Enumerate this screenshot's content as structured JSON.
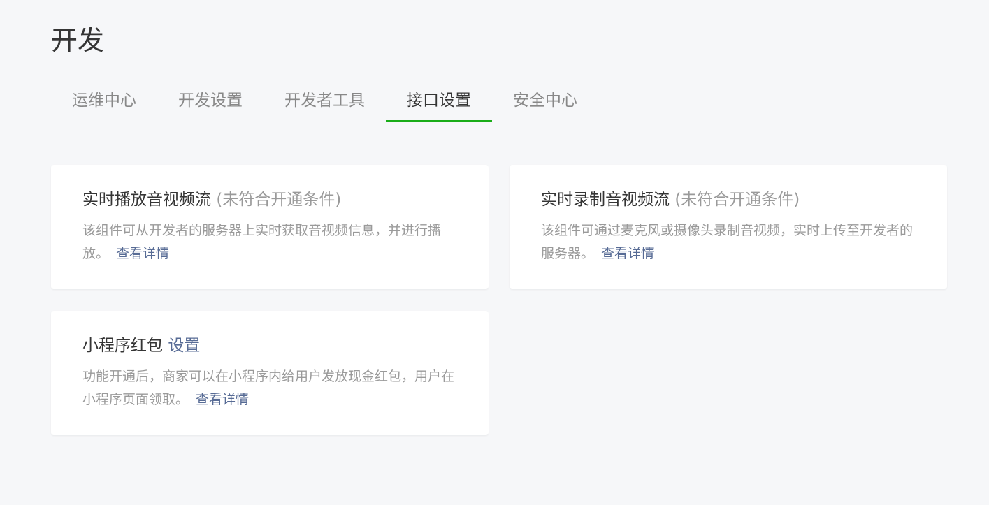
{
  "page": {
    "title": "开发"
  },
  "tabs": [
    {
      "label": "运维中心",
      "active": false
    },
    {
      "label": "开发设置",
      "active": false
    },
    {
      "label": "开发者工具",
      "active": false
    },
    {
      "label": "接口设置",
      "active": true
    },
    {
      "label": "安全中心",
      "active": false
    }
  ],
  "cards": [
    {
      "title": "实时播放音视频流",
      "status": "(未符合开通条件)",
      "description": "该组件可从开发者的服务器上实时获取音视频信息，并进行播放。",
      "link": "查看详情"
    },
    {
      "title": "实时录制音视频流",
      "status": "(未符合开通条件)",
      "description": "该组件可通过麦克风或摄像头录制音视频，实时上传至开发者的服务器。",
      "link": "查看详情"
    },
    {
      "title": "小程序红包",
      "action": "设置",
      "description": "功能开通后，商家可以在小程序内给用户发放现金红包，用户在小程序页面领取。",
      "link": "查看详情"
    }
  ],
  "colors": {
    "background": "#f6f7f9",
    "accent": "#1aad19",
    "link": "#576b95",
    "muted": "#9a9a9a",
    "text": "#353535"
  }
}
